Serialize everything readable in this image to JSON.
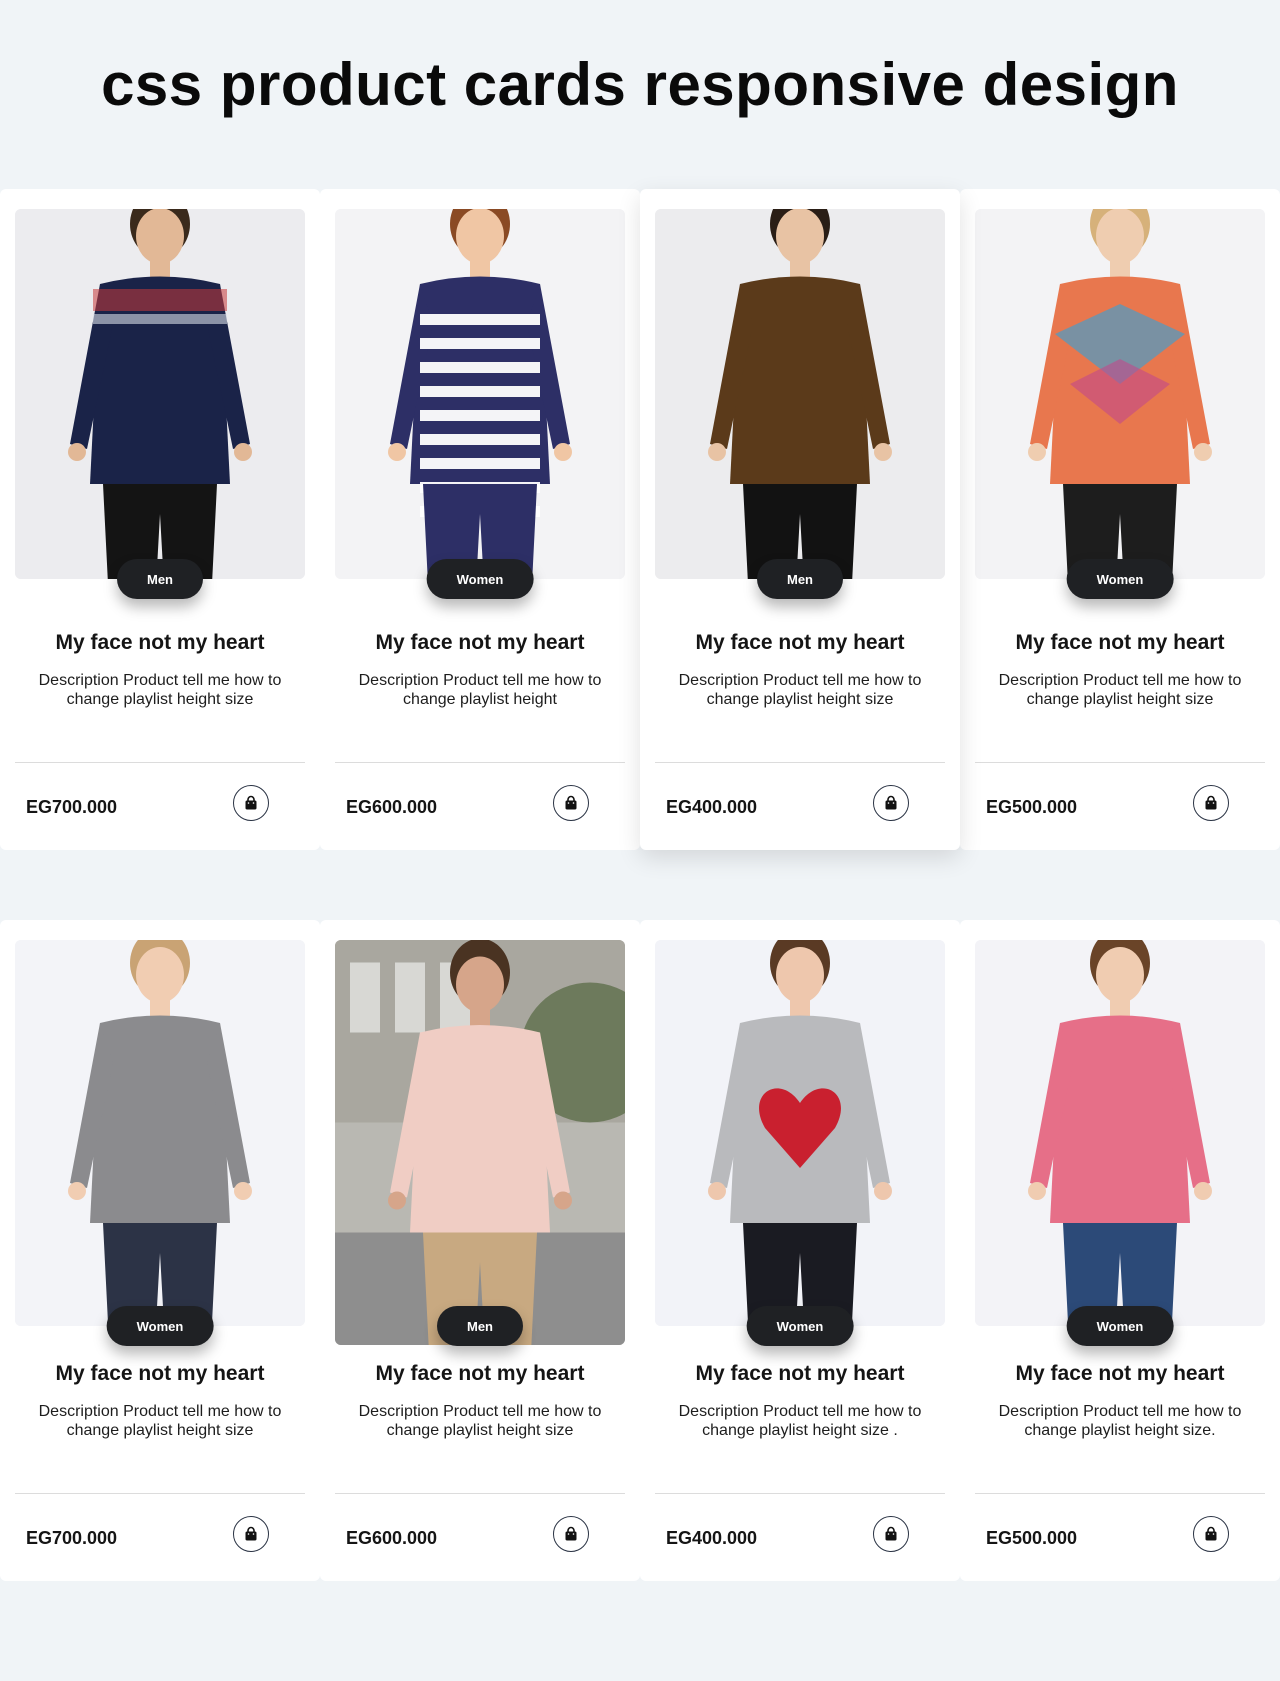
{
  "page": {
    "title": "css product cards responsive design"
  },
  "rows": [
    {
      "cards": [
        {
          "category": "Men",
          "title": "My face not my heart",
          "description": "Description Product tell me how to change playlist height size",
          "price": "EG700.000",
          "cart_icon": "shopping-bag-icon",
          "colors": {
            "bg": "#ececef",
            "top": "#1a2348",
            "accent": "#c93a3a",
            "bottom": "#141414",
            "skin": "#e2b896"
          }
        },
        {
          "category": "Women",
          "title": "My face not my heart",
          "description": "Description Product tell me how to change playlist height",
          "price": "EG600.000",
          "cart_icon": "shopping-bag-icon",
          "colors": {
            "bg": "#f3f3f5",
            "top": "#2d2f66",
            "accent": "#ffffff",
            "bottom": "#2d2f66",
            "skin": "#f0c6a4"
          }
        },
        {
          "category": "Men",
          "title": "My face not my heart",
          "description": "Description Product tell me how to change playlist height size",
          "price": "EG400.000",
          "cart_icon": "shopping-bag-icon",
          "colors": {
            "bg": "#ececee",
            "top": "#5b3a1a",
            "accent": "#7a5128",
            "bottom": "#121212",
            "skin": "#e8c3a4"
          }
        },
        {
          "category": "Women",
          "title": "My face not my heart",
          "description": "Description Product tell me how to change playlist height size",
          "price": "EG500.000",
          "cart_icon": "shopping-bag-icon",
          "colors": {
            "bg": "#f3f3f5",
            "top": "#e8774e",
            "accent": "#4a9cc7",
            "bottom": "#1d1d1d",
            "skin": "#efcdb0"
          }
        }
      ]
    },
    {
      "cards": [
        {
          "category": "Women",
          "title": "My face not my heart",
          "description": "Description Product tell me how to change playlist height size",
          "price": "EG700.000",
          "cart_icon": "shopping-bag-icon",
          "colors": {
            "bg": "#f3f4f8",
            "top": "#8b8b8e",
            "accent": "#a2a2a4",
            "bottom": "#2c3346",
            "skin": "#f1cdb2"
          }
        },
        {
          "category": "Men",
          "title": "My face not my heart",
          "description": "Description Product tell me how to change playlist height size",
          "price": "EG600.000",
          "cart_icon": "shopping-bag-icon",
          "colors": {
            "bg": "#b9b8b2",
            "top": "#f0cdc4",
            "accent": "#d2b89a",
            "bottom": "#c8a981",
            "skin": "#d6a58a"
          }
        },
        {
          "category": "Women",
          "title": "My face not my heart",
          "description": "Description Product tell me how to change playlist height size .",
          "price": "EG400.000",
          "cart_icon": "shopping-bag-icon",
          "colors": {
            "bg": "#f2f3f8",
            "top": "#b9babd",
            "accent": "#c9202f",
            "bottom": "#1a1b22",
            "skin": "#eec7ad"
          }
        },
        {
          "category": "Women",
          "title": "My face not my heart",
          "description": "Description Product tell me how to change playlist height size.",
          "price": "EG500.000",
          "cart_icon": "shopping-bag-icon",
          "colors": {
            "bg": "#f3f3f7",
            "top": "#e66f88",
            "accent": "#d85c78",
            "bottom": "#2c4a78",
            "skin": "#f0ccb1"
          }
        }
      ]
    }
  ]
}
